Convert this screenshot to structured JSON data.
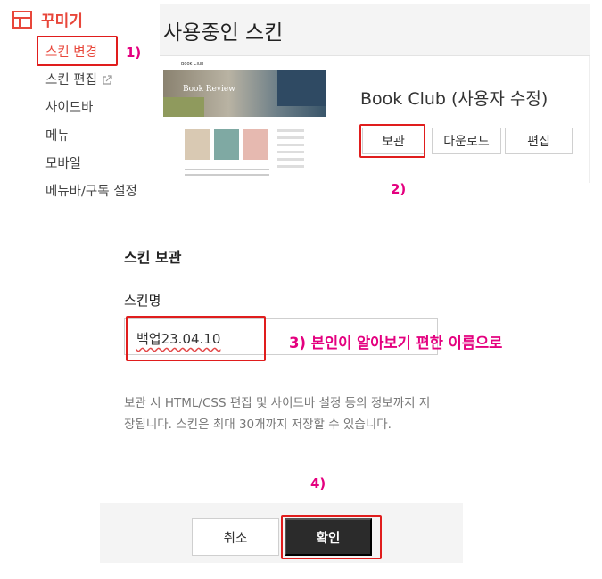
{
  "sidebar": {
    "title": "꾸미기",
    "items": [
      {
        "label": "스킨 변경"
      },
      {
        "label": "스킨 편집"
      },
      {
        "label": "사이드바"
      },
      {
        "label": "메뉴"
      },
      {
        "label": "모바일"
      },
      {
        "label": "메뉴바/구독 설정"
      }
    ]
  },
  "panel": {
    "title": "사용중인 스킨",
    "thumbnail": {
      "site_title": "Book Club",
      "hero_text": "Book Review"
    },
    "skin_name": "Book Club (사용자 수정)",
    "buttons": {
      "save": "보관",
      "download": "다운로드",
      "edit": "편집"
    }
  },
  "dialog": {
    "title": "스킨 보관",
    "field_label": "스킨명",
    "input_value": "백업23.04.10",
    "description": "보관 시 HTML/CSS 편집 및 사이드바 설정 등의 정보까지 저장됩니다. 스킨은 최대 30개까지 저장할 수 있습니다.",
    "cancel": "취소",
    "confirm": "확인"
  },
  "annotations": {
    "step1": "1)",
    "step2": "2)",
    "step3": "3) 본인이 알아보기 편한 이름으로",
    "step4": "4)"
  },
  "colors": {
    "accent": "#e8473b",
    "highlight_box": "#e01d1d",
    "annotation": "#e4007f"
  }
}
